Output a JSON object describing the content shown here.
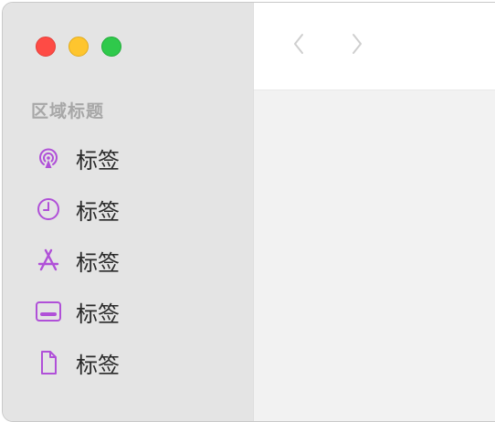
{
  "window": {
    "controls": [
      "close",
      "minimize",
      "zoom"
    ]
  },
  "toolbar": {
    "back_icon": "chevron-left-icon",
    "forward_icon": "chevron-right-icon"
  },
  "sidebar": {
    "section_title": "区域标题",
    "items": [
      {
        "label": "标签",
        "icon": "airdrop-icon"
      },
      {
        "label": "标签",
        "icon": "clock-icon"
      },
      {
        "label": "标签",
        "icon": "app-store-icon"
      },
      {
        "label": "标签",
        "icon": "desktop-icon"
      },
      {
        "label": "标签",
        "icon": "document-icon"
      }
    ]
  },
  "colors": {
    "accent": "#b050d8",
    "sidebar_bg": "#e4e4e4",
    "content_bg": "#f2f2f2",
    "close": "#fe4b45",
    "minimize": "#fec52e",
    "zoom": "#2fc94b"
  }
}
